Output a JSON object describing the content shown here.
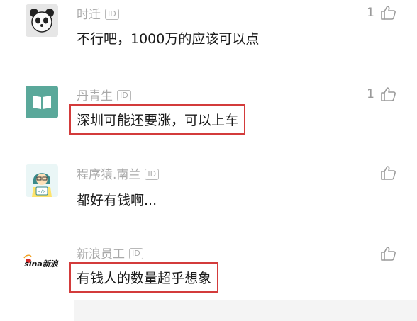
{
  "comments": [
    {
      "name": "时迁",
      "id_badge": "ID",
      "text": "不行吧，1000万的应该可以点",
      "likes": "1",
      "avatar_icon": "panda-avatar-icon"
    },
    {
      "name": "丹青生",
      "id_badge": "ID",
      "text": "深圳可能还要涨，可以上车",
      "likes": "1",
      "avatar_icon": "book-avatar-icon"
    },
    {
      "name": "程序猿.南兰",
      "id_badge": "ID",
      "text": "都好有钱啊...",
      "likes": "",
      "avatar_icon": "programmer-avatar-icon"
    },
    {
      "name": "新浪员工",
      "id_badge": "ID",
      "text": "有钱人的数量超乎想象",
      "likes": "",
      "avatar_icon": "sina-avatar-icon",
      "avatar_logo_text": "sina新浪"
    }
  ],
  "colors": {
    "highlight_border": "#d33b3b",
    "name_gray": "#a9a9a9",
    "book_teal": "#5aa89a"
  }
}
